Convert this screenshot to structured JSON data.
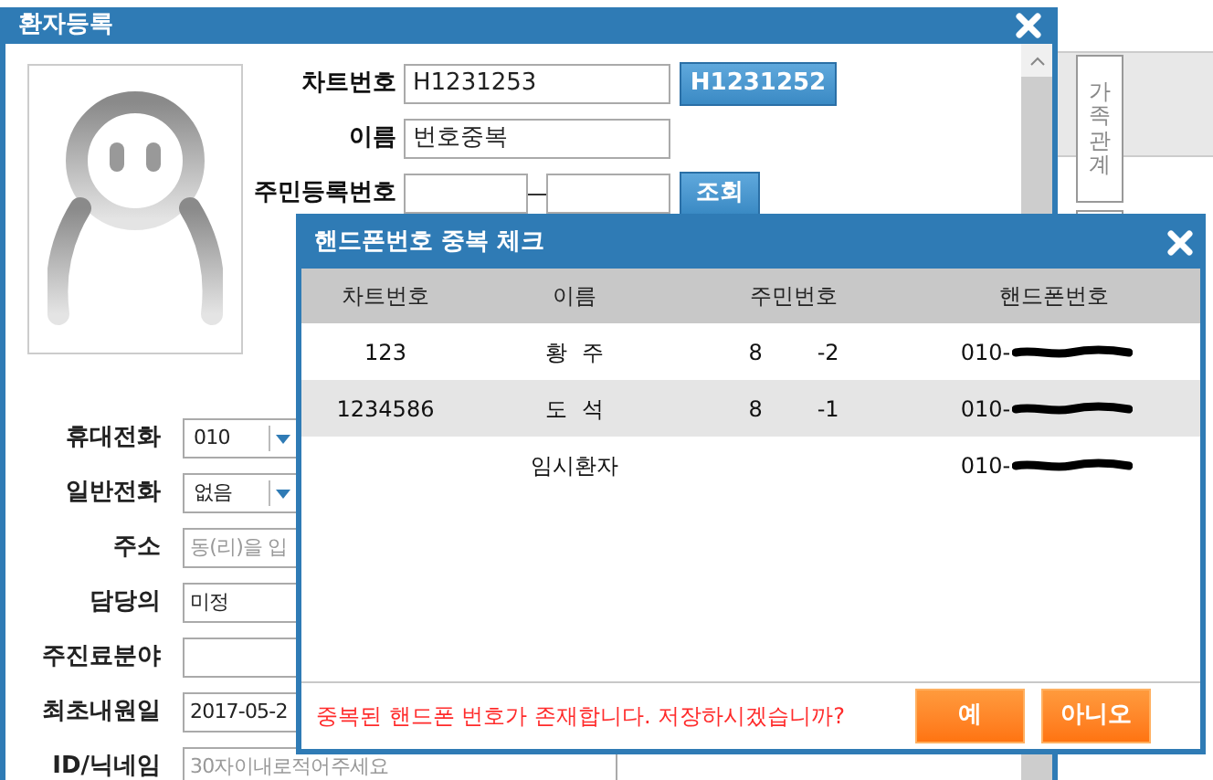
{
  "window": {
    "title": "환자등록"
  },
  "top_fields": [
    {
      "kind": "text_button",
      "label": "차트번호",
      "value": "H1231253",
      "button": "H1231252"
    },
    {
      "kind": "text",
      "label": "이름",
      "value": "번호중복"
    },
    {
      "kind": "split_button",
      "label": "주민등록번호",
      "button": "조회"
    }
  ],
  "side_tab": {
    "label": "가족관계"
  },
  "form_fields": [
    {
      "kind": "select",
      "label": "휴대전화",
      "value": "010"
    },
    {
      "kind": "select",
      "label": "일반전화",
      "value": "없음"
    },
    {
      "kind": "input",
      "label": "주소",
      "placeholder": "동(리)을 입"
    },
    {
      "kind": "input",
      "label": "담당의",
      "value": "미정"
    },
    {
      "kind": "input",
      "label": "주진료분야"
    },
    {
      "kind": "input",
      "label": "최초내원일",
      "value": "2017-05-2"
    },
    {
      "kind": "input",
      "label": "ID/닉네임",
      "placeholder": "30자이내로적어주세요"
    }
  ],
  "dialog": {
    "title": "핸드폰번호 중복 체크",
    "columns": [
      "차트번호",
      "이름",
      "주민번호",
      "핸드폰번호"
    ],
    "rows": [
      {
        "chart_no": "123",
        "name": "황  주",
        "id_front": "8",
        "id_back": "-2",
        "phone": "010-"
      },
      {
        "chart_no": "1234586",
        "name": "도  석",
        "id_front": "8",
        "id_back": "-1",
        "phone": "010-"
      },
      {
        "name": "임시환자",
        "phone": "010-"
      }
    ],
    "message": "중복된 핸드폰 번호가 존재합니다. 저장하시겠습니까?",
    "buttons": [
      "예",
      "아니오"
    ]
  }
}
